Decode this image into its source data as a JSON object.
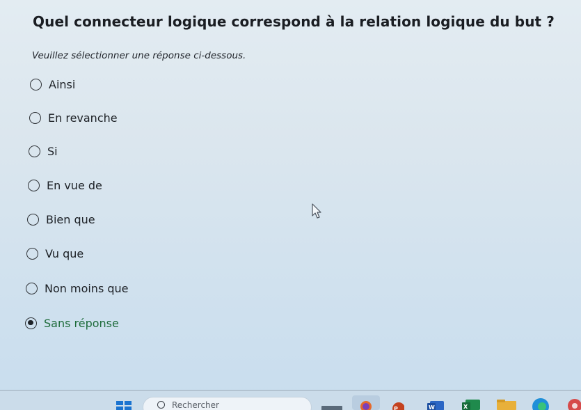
{
  "question": {
    "title": "Quel connecteur logique correspond à la relation logique du but ?",
    "instruction": "Veuillez sélectionner une réponse ci-dessous."
  },
  "options": [
    {
      "label": "Ainsi",
      "selected": false
    },
    {
      "label": "En revanche",
      "selected": false
    },
    {
      "label": "Si",
      "selected": false
    },
    {
      "label": "En vue de",
      "selected": false
    },
    {
      "label": "Bien que",
      "selected": false
    },
    {
      "label": "Vu que",
      "selected": false
    },
    {
      "label": "Non moins que",
      "selected": false
    },
    {
      "label": "Sans réponse",
      "selected": true
    }
  ],
  "taskbar": {
    "search_placeholder": "Rechercher",
    "icons": [
      "start-icon",
      "search-icon",
      "task-view-icon",
      "firefox-icon",
      "powerpoint-icon",
      "word-icon",
      "excel-icon",
      "file-explorer-icon",
      "edge-icon",
      "app-icon"
    ]
  },
  "colors": {
    "selected_text": "#1d6b3a",
    "background": "#d6e4ef"
  }
}
